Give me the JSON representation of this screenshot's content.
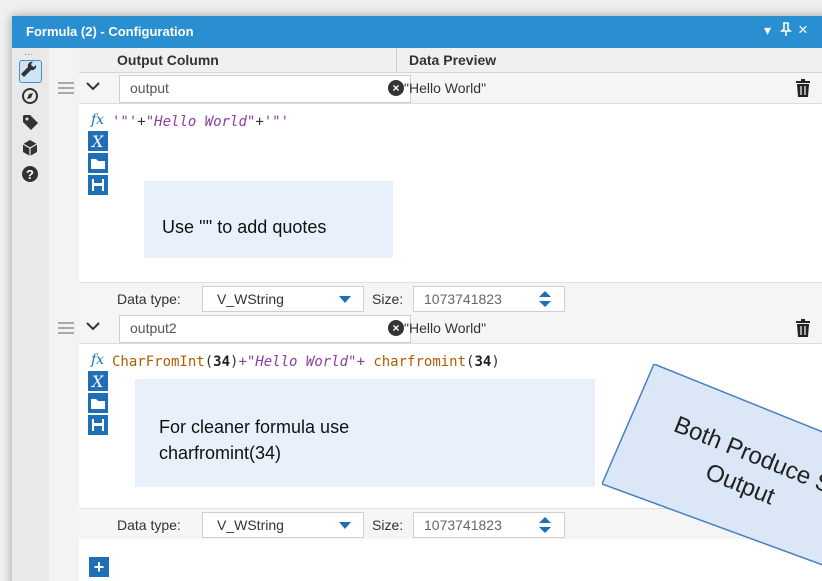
{
  "window": {
    "title": "Formula (2) - Configuration",
    "controls": [
      "▾",
      "⊥",
      "×"
    ]
  },
  "toolbar": {
    "tools": [
      "wrench-icon",
      "compass-icon",
      "tag-icon",
      "cube-icon",
      "help-icon"
    ],
    "dots": "..."
  },
  "columns": {
    "output_column": "Output Column",
    "data_preview": "Data Preview"
  },
  "rows": [
    {
      "name": "output",
      "preview": "\"Hello World\"",
      "formula": {
        "q1": "'\"'",
        "plus1": "+",
        "str": "\"Hello World\"",
        "plus2": "+",
        "q2": "'\"'"
      },
      "note": "Use '\"' to add quotes",
      "data_type_label": "Data type:",
      "data_type": "V_WString",
      "size_label": "Size:",
      "size": "1073741823"
    },
    {
      "name": "output2",
      "preview": "\"Hello World\"",
      "formula": {
        "fn1": "CharFromInt",
        "open1": "(",
        "n1": "34",
        "close1": ")",
        "plus1": "+",
        "str": "\"Hello World\"",
        "plus2": "+ ",
        "fn2": "charfromint",
        "open2": "(",
        "n2": "34",
        "close2": ")"
      },
      "note_line1": "For cleaner formula use",
      "note_line2": "charfromint(34)",
      "data_type_label": "Data type:",
      "data_type": "V_WString",
      "size_label": "Size:",
      "size": "1073741823"
    }
  ],
  "callout": {
    "line1": "Both Produce Same",
    "line2": "Output"
  },
  "add_button": "+"
}
